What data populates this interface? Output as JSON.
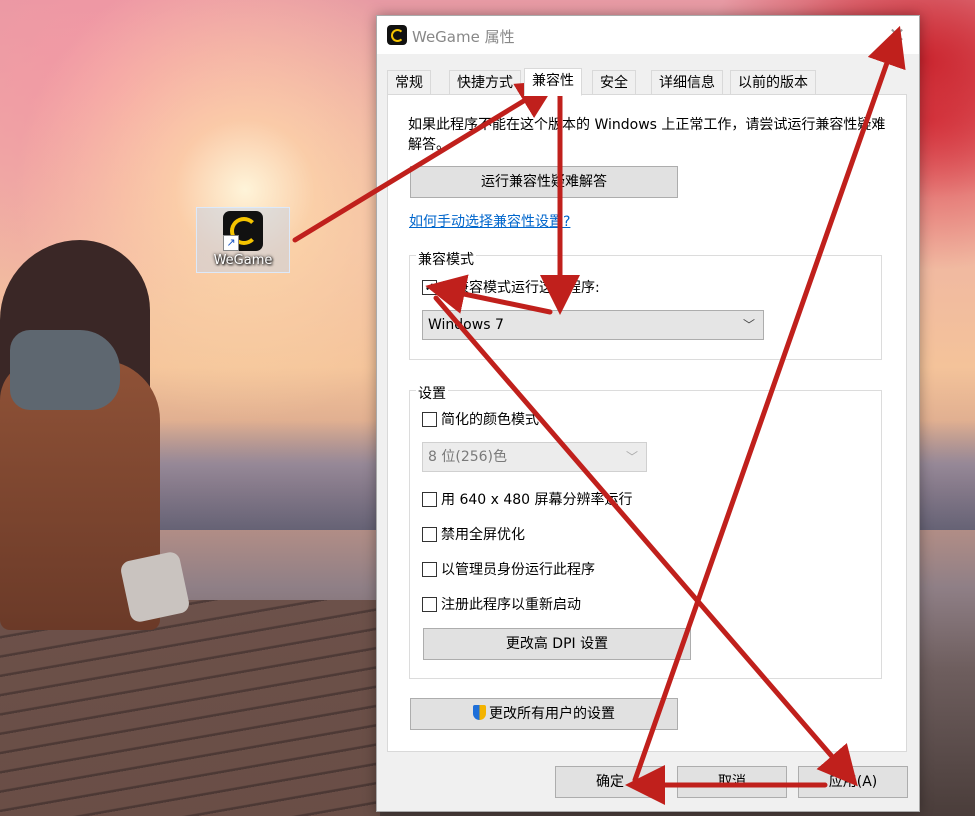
{
  "desktop": {
    "icon_label": "WeGame"
  },
  "dialog": {
    "title": "WeGame 属性",
    "close_glyph": "✕",
    "tabs": [
      {
        "label": "常规"
      },
      {
        "label": "快捷方式"
      },
      {
        "label": "兼容性"
      },
      {
        "label": "安全"
      },
      {
        "label": "详细信息"
      },
      {
        "label": "以前的版本"
      }
    ],
    "intro_text": "如果此程序不能在这个版本的 Windows 上正常工作，请尝试运行兼容性疑难解答。",
    "troubleshoot_button": "运行兼容性疑难解答",
    "manual_link": "如何手动选择兼容性设置?",
    "compat_mode": {
      "group_title": "兼容模式",
      "checkbox_label": "以兼容模式运行这个程序:",
      "checked": true,
      "selected_os": "Windows 7"
    },
    "settings": {
      "group_title": "设置",
      "reduced_color_label": "简化的颜色模式",
      "color_select_value": "8 位(256)色",
      "resolution_label": "用 640 x 480 屏幕分辨率运行",
      "fullscreen_label": "禁用全屏优化",
      "admin_label": "以管理员身份运行此程序",
      "restart_label": "注册此程序以重新启动",
      "dpi_button": "更改高 DPI 设置"
    },
    "all_users_button": "更改所有用户的设置",
    "footer": {
      "ok": "确定",
      "cancel": "取消",
      "apply": "应用(A)"
    }
  },
  "colors": {
    "arrow": "#c0201c",
    "link": "#0066cc",
    "checkmark": "✓"
  }
}
